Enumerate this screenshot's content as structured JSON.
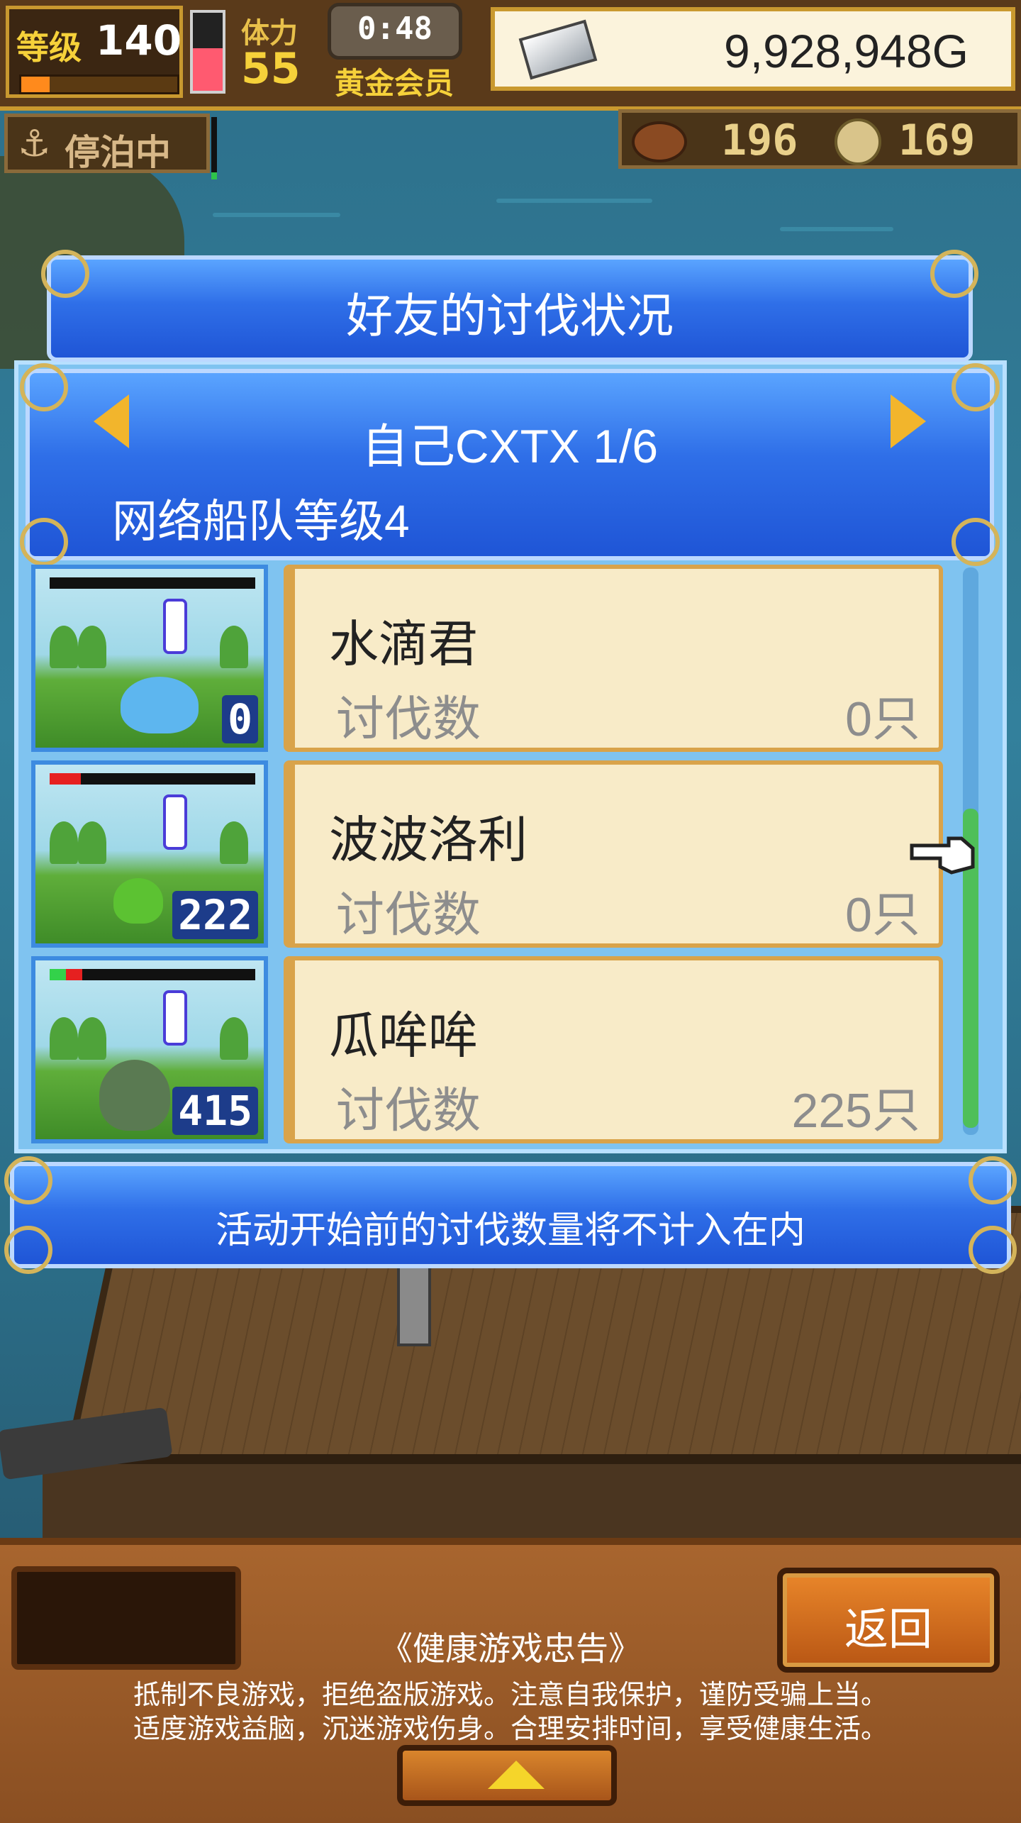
{
  "hud": {
    "level_label": "等级",
    "level_value": "140",
    "exp_progress": 0.18,
    "stamina_label": "体力",
    "stamina_value": "55",
    "stamina_fill": 0.55,
    "timer": "0:48",
    "membership": "黄金会员",
    "money": "9,928,948G"
  },
  "status": {
    "anchored_icon": "anchor-icon",
    "anchored_label": "停泊中",
    "meat_count": "196",
    "coin_count": "169"
  },
  "dialog": {
    "title": "好友的讨伐状况",
    "friend_name": "自己CXTX 1/6",
    "fleet_level": "网络船队等级4",
    "monsters": [
      {
        "name": "水滴君",
        "kill_label": "讨伐数",
        "kill_count": "0只",
        "thumb_count": "0",
        "hp_red": 0,
        "hp_green": 0,
        "color": "#5db6ef"
      },
      {
        "name": "波波洛利",
        "kill_label": "讨伐数",
        "kill_count": "0只",
        "thumb_count": "222",
        "hp_red": 0.15,
        "hp_green": 0,
        "color": "#5cc232"
      },
      {
        "name": "瓜哞哞",
        "kill_label": "讨伐数",
        "kill_count": "225只",
        "thumb_count": "415",
        "hp_red": 0.16,
        "hp_green": 0.08,
        "color": "#5a7a52"
      }
    ],
    "notice": "活动开始前的讨伐数量将不计入在内"
  },
  "bottom": {
    "back_label": "返回",
    "health_title": "《健康游戏忠告》",
    "health_line1": "抵制不良游戏，拒绝盗版游戏。注意自我保护，谨防受骗上当。",
    "health_line2": "适度游戏益脑，沉迷游戏伤身。合理安排时间，享受健康生活。"
  },
  "colors": {
    "banner_blue": "#2f6fe8",
    "card_cream": "#f8ebc8",
    "gold_text": "#f6d13a",
    "button_orange": "#e9862a"
  }
}
